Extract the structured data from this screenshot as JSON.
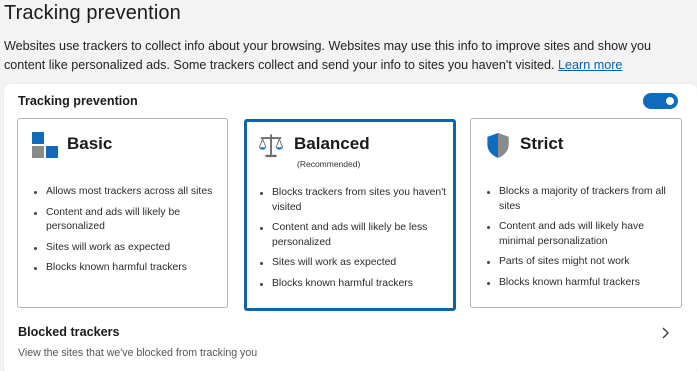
{
  "header": {
    "title": "Tracking prevention",
    "description": "Websites use trackers to collect info about your browsing. Websites may use this info to improve sites and show you content like personalized ads. Some trackers collect and send your info to sites you haven't visited.",
    "learn_more": "Learn more"
  },
  "panel": {
    "title": "Tracking prevention",
    "toggle_on": true
  },
  "options": {
    "basic": {
      "label": "Basic",
      "icon": "basic-blocks-icon",
      "items": [
        "Allows most trackers across all sites",
        "Content and ads will likely be personalized",
        "Sites will work as expected",
        "Blocks known harmful trackers"
      ]
    },
    "balanced": {
      "label": "Balanced",
      "sub": "(Recommended)",
      "icon": "scales-icon",
      "selected": true,
      "items": [
        "Blocks trackers from sites you haven't visited",
        "Content and ads will likely be less personalized",
        "Sites will work as expected",
        "Blocks known harmful trackers"
      ]
    },
    "strict": {
      "label": "Strict",
      "icon": "shield-icon",
      "items": [
        "Blocks a majority of trackers from all sites",
        "Content and ads will likely have minimal personalization",
        "Parts of sites might not work",
        "Blocks known harmful trackers"
      ]
    }
  },
  "blocked": {
    "title": "Blocked trackers",
    "subtitle": "View the sites that we've blocked from tracking you"
  },
  "colors": {
    "accent": "#0f6cbd",
    "selected_border": "#0f64a7",
    "link": "#0f5ea8"
  }
}
